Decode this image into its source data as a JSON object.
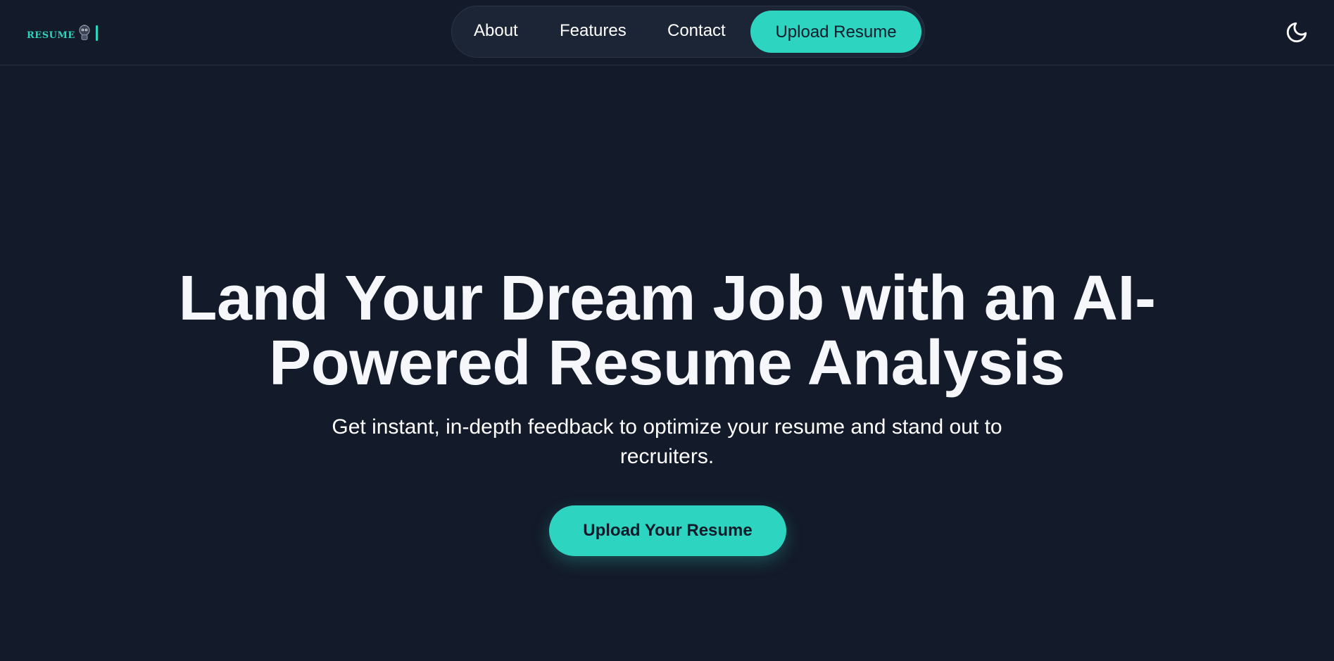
{
  "brand": {
    "logo_text": "RESUME",
    "logo_icon": "robot-mascot-icon",
    "accent_color": "#2dd4bf",
    "background_color": "#131a29"
  },
  "nav": {
    "items": [
      {
        "label": "About"
      },
      {
        "label": "Features"
      },
      {
        "label": "Contact"
      }
    ],
    "upload_button": "Upload Resume"
  },
  "theme_toggle": {
    "icon": "moon-icon"
  },
  "hero": {
    "title": "Land Your Dream Job with an AI-Powered Resume Analysis",
    "subtitle": "Get instant, in-depth feedback to optimize your resume and stand out to recruiters.",
    "cta_label": "Upload Your Resume"
  }
}
